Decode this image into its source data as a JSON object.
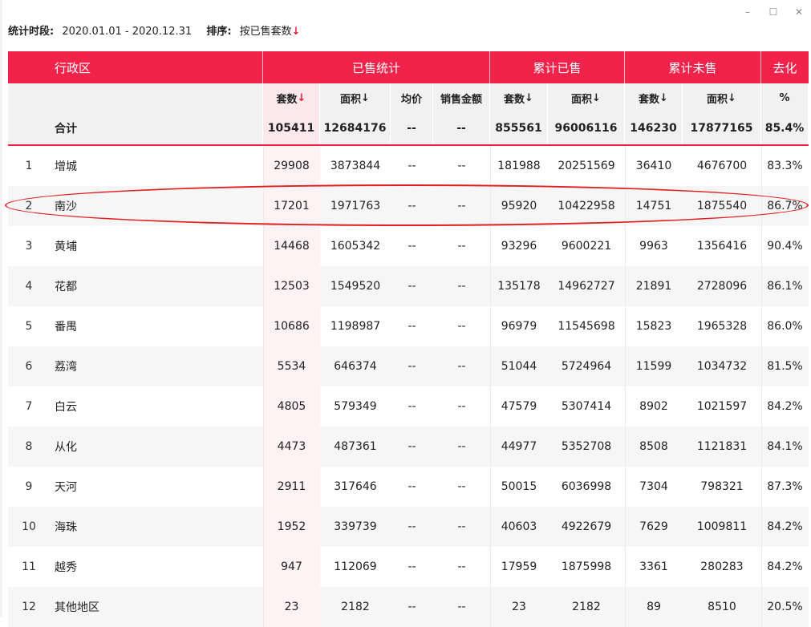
{
  "window": {
    "minimize": "–",
    "maximize": "☐",
    "close": "✕"
  },
  "filter": {
    "period_label": "统计时段:",
    "period_value": "2020.01.01 - 2020.12.31",
    "sort_label": "排序:",
    "sort_value": "按已售套数",
    "sort_arrow": "↓"
  },
  "header": {
    "district": "行政区",
    "sold_stats": "已售统计",
    "cum_sold": "累计已售",
    "cum_unsold": "累计未售",
    "destock": "去化"
  },
  "subheader": {
    "sold_units": "套数",
    "sold_area": "面积",
    "avg_price": "均价",
    "sales_amount": "销售金额",
    "cum_sold_units": "套数",
    "cum_sold_area": "面积",
    "cum_unsold_units": "套数",
    "cum_unsold_area": "面积",
    "destock_pct": "%",
    "arrow": "↓"
  },
  "total": {
    "label": "合计",
    "sold_units": "105411",
    "sold_area": "12684176",
    "avg_price": "--",
    "sales_amount": "--",
    "cum_sold_units": "855561",
    "cum_sold_area": "96006116",
    "cum_unsold_units": "146230",
    "cum_unsold_area": "17877165",
    "destock": "85.4%"
  },
  "rows": [
    {
      "rank": "1",
      "name": "增城",
      "sold_units": "29908",
      "sold_area": "3873844",
      "avg_price": "--",
      "sales_amount": "--",
      "cum_sold_units": "181988",
      "cum_sold_area": "20251569",
      "cum_unsold_units": "36410",
      "cum_unsold_area": "4676700",
      "destock": "83.3%"
    },
    {
      "rank": "2",
      "name": "南沙",
      "sold_units": "17201",
      "sold_area": "1971763",
      "avg_price": "--",
      "sales_amount": "--",
      "cum_sold_units": "95920",
      "cum_sold_area": "10422958",
      "cum_unsold_units": "14751",
      "cum_unsold_area": "1875540",
      "destock": "86.7%"
    },
    {
      "rank": "3",
      "name": "黄埔",
      "sold_units": "14468",
      "sold_area": "1605342",
      "avg_price": "--",
      "sales_amount": "--",
      "cum_sold_units": "93296",
      "cum_sold_area": "9600221",
      "cum_unsold_units": "9963",
      "cum_unsold_area": "1356416",
      "destock": "90.4%"
    },
    {
      "rank": "4",
      "name": "花都",
      "sold_units": "12503",
      "sold_area": "1549520",
      "avg_price": "--",
      "sales_amount": "--",
      "cum_sold_units": "135178",
      "cum_sold_area": "14962727",
      "cum_unsold_units": "21891",
      "cum_unsold_area": "2728096",
      "destock": "86.1%"
    },
    {
      "rank": "5",
      "name": "番禺",
      "sold_units": "10686",
      "sold_area": "1198987",
      "avg_price": "--",
      "sales_amount": "--",
      "cum_sold_units": "96979",
      "cum_sold_area": "11545698",
      "cum_unsold_units": "15823",
      "cum_unsold_area": "1965328",
      "destock": "86.0%"
    },
    {
      "rank": "6",
      "name": "荔湾",
      "sold_units": "5534",
      "sold_area": "646374",
      "avg_price": "--",
      "sales_amount": "--",
      "cum_sold_units": "51044",
      "cum_sold_area": "5724964",
      "cum_unsold_units": "11599",
      "cum_unsold_area": "1034732",
      "destock": "81.5%"
    },
    {
      "rank": "7",
      "name": "白云",
      "sold_units": "4805",
      "sold_area": "579349",
      "avg_price": "--",
      "sales_amount": "--",
      "cum_sold_units": "47579",
      "cum_sold_area": "5307414",
      "cum_unsold_units": "8902",
      "cum_unsold_area": "1021597",
      "destock": "84.2%"
    },
    {
      "rank": "8",
      "name": "从化",
      "sold_units": "4473",
      "sold_area": "487361",
      "avg_price": "--",
      "sales_amount": "--",
      "cum_sold_units": "44977",
      "cum_sold_area": "5352708",
      "cum_unsold_units": "8508",
      "cum_unsold_area": "1121831",
      "destock": "84.1%"
    },
    {
      "rank": "9",
      "name": "天河",
      "sold_units": "2911",
      "sold_area": "317646",
      "avg_price": "--",
      "sales_amount": "--",
      "cum_sold_units": "50015",
      "cum_sold_area": "6036998",
      "cum_unsold_units": "7304",
      "cum_unsold_area": "798321",
      "destock": "87.3%"
    },
    {
      "rank": "10",
      "name": "海珠",
      "sold_units": "1952",
      "sold_area": "339739",
      "avg_price": "--",
      "sales_amount": "--",
      "cum_sold_units": "40603",
      "cum_sold_area": "4922679",
      "cum_unsold_units": "7629",
      "cum_unsold_area": "1009811",
      "destock": "84.2%"
    },
    {
      "rank": "11",
      "name": "越秀",
      "sold_units": "947",
      "sold_area": "112069",
      "avg_price": "--",
      "sales_amount": "--",
      "cum_sold_units": "17959",
      "cum_sold_area": "1875998",
      "cum_unsold_units": "3361",
      "cum_unsold_area": "280283",
      "destock": "84.2%"
    },
    {
      "rank": "12",
      "name": "其他地区",
      "sold_units": "23",
      "sold_area": "2182",
      "avg_price": "--",
      "sales_amount": "--",
      "cum_sold_units": "23",
      "cum_sold_area": "2182",
      "cum_unsold_units": "89",
      "cum_unsold_area": "8510",
      "destock": "20.5%"
    }
  ],
  "colors": {
    "accent": "#f2234b",
    "highlight_circle": "#e02020"
  }
}
